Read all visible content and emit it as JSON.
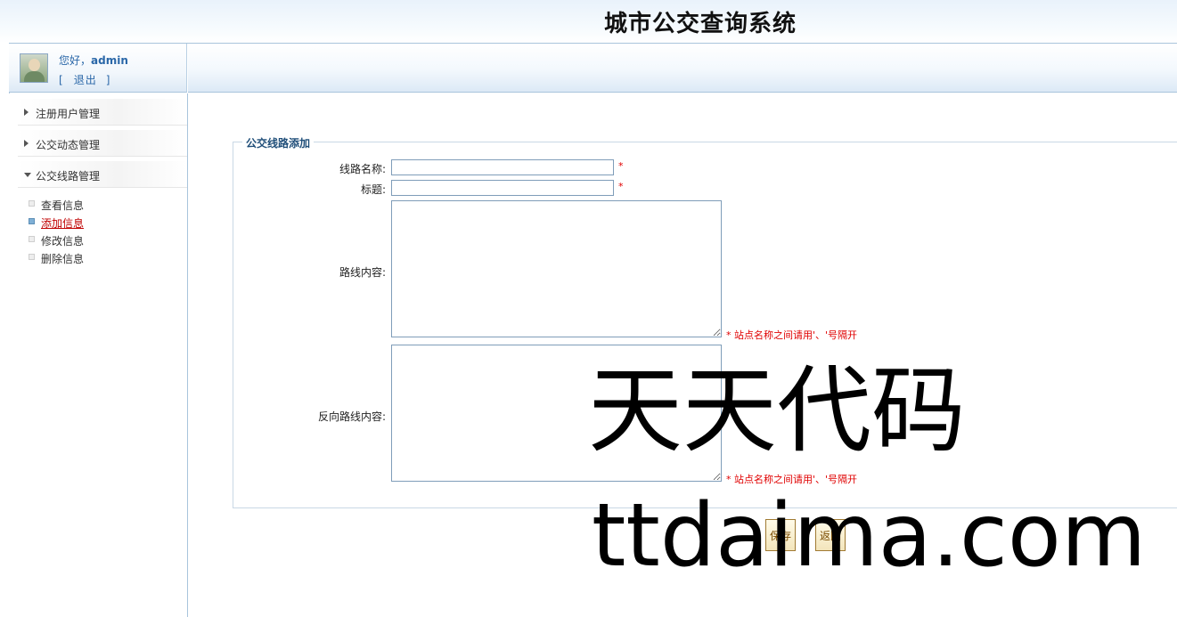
{
  "app": {
    "title": "城市公交查询系统"
  },
  "user": {
    "greeting": "您好，",
    "name": "admin",
    "bracket_left": "[",
    "logout_label": "退出",
    "bracket_right": "]"
  },
  "sidebar": {
    "groups": [
      {
        "label": "注册用户管理",
        "expanded": false
      },
      {
        "label": "公交动态管理",
        "expanded": false
      },
      {
        "label": "公交线路管理",
        "expanded": true
      }
    ],
    "sub_items": [
      {
        "label": "查看信息",
        "active": false
      },
      {
        "label": "添加信息",
        "active": true
      },
      {
        "label": "修改信息",
        "active": false
      },
      {
        "label": "删除信息",
        "active": false
      }
    ]
  },
  "form": {
    "legend": "公交线路添加",
    "fields": {
      "route_name": {
        "label": "线路名称:",
        "value": "",
        "required_mark": "*"
      },
      "title": {
        "label": "标题:",
        "value": "",
        "required_mark": "*"
      },
      "route_content": {
        "label": "路线内容:",
        "value": "",
        "hint": "* 站点名称之间请用'、'号隔开"
      },
      "reverse_content": {
        "label": "反向路线内容:",
        "value": "",
        "hint": "* 站点名称之间请用'、'号隔开"
      }
    },
    "buttons": {
      "save": "保存",
      "back": "返回"
    }
  },
  "watermark": {
    "line1": "天天代码",
    "line2": "ttdaima.com"
  },
  "colors": {
    "accent": "#2a67a8",
    "required": "#e00000",
    "border": "#a9c4dc"
  }
}
